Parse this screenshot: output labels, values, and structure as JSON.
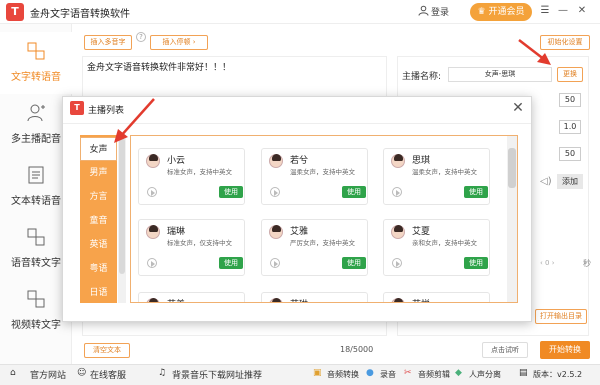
{
  "app": {
    "title": "金舟文字语音转换软件",
    "login": "登录",
    "vip": "开通会员"
  },
  "sidebar": {
    "items": [
      {
        "label": "文字转语音"
      },
      {
        "label": "多主播配音"
      },
      {
        "label": "文本转语音"
      },
      {
        "label": "语音转文字"
      },
      {
        "label": "视频转文字"
      }
    ]
  },
  "toolbar": {
    "insert_polyphone": "插入多音字",
    "insert_pause": "插入停顿",
    "help": "?",
    "init_settings": "初始化设置"
  },
  "editor": {
    "text": "金舟文字语音转换软件非常好！！！",
    "char_count": "18/5000",
    "clear_button": "清空文本"
  },
  "right": {
    "anchor_label": "主播名称:",
    "anchor_value": "女声-思琪",
    "change_button": "更换",
    "values": [
      "50",
      "1.0",
      "50"
    ],
    "add_button": "添加",
    "seconds_label": "秒",
    "open_output": "打开输出目录",
    "trial_button": "点击试听",
    "convert_button": "开始转换"
  },
  "modal": {
    "title": "主播列表",
    "languages": [
      "女声",
      "男声",
      "方言",
      "童音",
      "英语",
      "粤语",
      "日语"
    ],
    "cards": [
      {
        "name": "小云",
        "desc": "标准女声，支持中英文",
        "use": "使用"
      },
      {
        "name": "若兮",
        "desc": "温柔女声，支持中英文",
        "use": "使用"
      },
      {
        "name": "思琪",
        "desc": "温柔女声，支持中英文",
        "use": "使用"
      },
      {
        "name": "瑞琳",
        "desc": "标准女声，仅支持中文",
        "use": "使用"
      },
      {
        "name": "艾雅",
        "desc": "严厉女声，支持中英文",
        "use": "使用"
      },
      {
        "name": "艾夏",
        "desc": "亲和女声，支持中英文",
        "use": "使用"
      },
      {
        "name": "艾美",
        "desc": "",
        "use": ""
      },
      {
        "name": "艾琳",
        "desc": "",
        "use": ""
      },
      {
        "name": "艾悦",
        "desc": "",
        "use": ""
      }
    ]
  },
  "bottom": {
    "items": [
      "官方网站",
      "在线客服",
      "背景音乐下载网址推荐",
      "音频转换",
      "录音",
      "音频剪辑",
      "人声分离"
    ],
    "version": "版本：v2.5.2"
  },
  "colors": {
    "accent": "#f08a24",
    "green": "#2fa34a",
    "brand_red": "#e8473d"
  }
}
